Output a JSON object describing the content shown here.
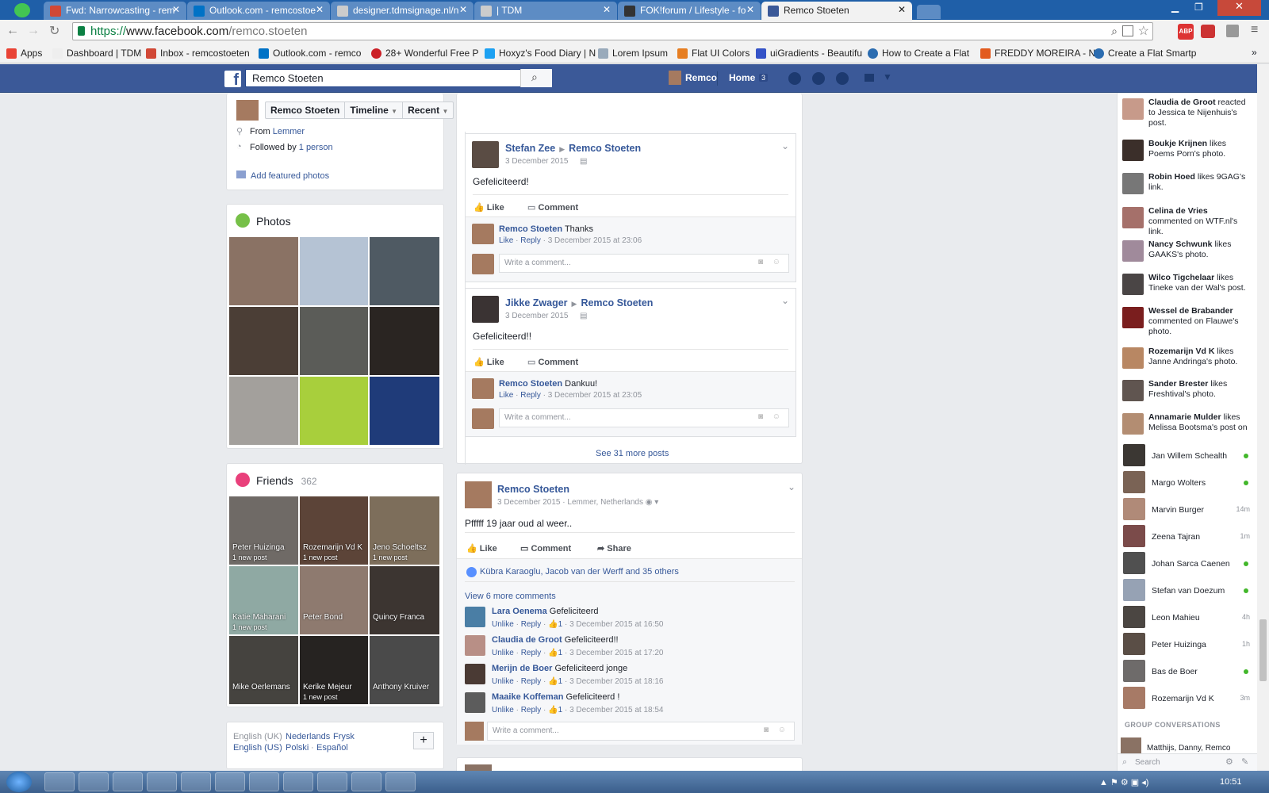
{
  "browser": {
    "tabs": [
      {
        "label": "Fwd: Narrowcasting - rem",
        "active": false
      },
      {
        "label": "Outlook.com - remcostoe",
        "active": false
      },
      {
        "label": "designer.tdmsignage.nl/n",
        "active": false
      },
      {
        "label": "| TDM",
        "active": false
      },
      {
        "label": "FOK!forum / Lifestyle - fo",
        "active": false
      },
      {
        "label": "Remco Stoeten",
        "active": true
      }
    ],
    "url_scheme": "https://",
    "url_host": "www.facebook.com",
    "url_path": "/remco.stoeten",
    "bookmarks": [
      "Apps",
      "Dashboard | TDM",
      "Inbox - remcostoeten",
      "Outlook.com - remco",
      "28+ Wonderful Free P",
      "Hoxyz's Food Diary | N",
      "Lorem Ipsum",
      "Flat UI Colors",
      "uiGradients - Beautifu",
      "How to Create a Flat",
      "FREDDY MOREIRA - N",
      "Create a Flat Smartph"
    ]
  },
  "fb": {
    "search_value": "Remco Stoeten",
    "nav_profile": "Remco",
    "nav_home": "Home",
    "nav_home_count": "3"
  },
  "profile_bar": {
    "name": "Remco Stoeten",
    "timeline": "Timeline",
    "recent": "Recent"
  },
  "intro": {
    "from_label": "From",
    "from_value": "Lemmer",
    "followed_label": "Followed by",
    "followed_value": "1 person",
    "featured": "Add featured photos"
  },
  "photos": {
    "title": "Photos"
  },
  "friends": {
    "title": "Friends",
    "count": "362",
    "items": [
      {
        "name": "Peter Huizinga",
        "sub": "1 new post"
      },
      {
        "name": "Rozemarijn Vd K",
        "sub": "1 new post"
      },
      {
        "name": "Jeno Schoeltsz",
        "sub": "1 new post"
      },
      {
        "name": "Katie Maharani",
        "sub": "1 new post"
      },
      {
        "name": "Peter Bond",
        "sub": ""
      },
      {
        "name": "Quincy Franca",
        "sub": ""
      },
      {
        "name": "Mike Oerlemans",
        "sub": ""
      },
      {
        "name": "Kerike Mejeur",
        "sub": "1 new post"
      },
      {
        "name": "Anthony Kruiver",
        "sub": ""
      }
    ]
  },
  "languages": {
    "current": "English (UK)",
    "l1": "Nederlands",
    "l2": "Frysk",
    "l3": "English (US)",
    "l4": "Polski",
    "l5": "Español"
  },
  "posts": [
    {
      "author": "Stefan Zee",
      "target": "Remco Stoeten",
      "date": "3 December 2015",
      "text": "Gefeliciteerd!",
      "like": "Like",
      "comment": "Comment",
      "reply_author": "Remco Stoeten",
      "reply_text": "Thanks",
      "reply_like": "Like",
      "reply_reply": "Reply",
      "reply_date": "3 December 2015 at 23:06",
      "write": "Write a comment..."
    },
    {
      "author": "Jikke Zwager",
      "target": "Remco Stoeten",
      "date": "3 December 2015",
      "text": "Gefeliciteerd!!",
      "like": "Like",
      "comment": "Comment",
      "reply_author": "Remco Stoeten",
      "reply_text": "Dankuu!",
      "reply_like": "Like",
      "reply_reply": "Reply",
      "reply_date": "3 December 2015 at 23:05",
      "write": "Write a comment..."
    }
  ],
  "see_more": "See 31 more posts",
  "main_post": {
    "author": "Remco Stoeten",
    "date": "3 December 2015",
    "location": "Lemmer, Netherlands",
    "text": "Pfffff 19 jaar oud al weer..",
    "like": "Like",
    "comment": "Comment",
    "share": "Share",
    "likes_line": "Kübra Karaoglu, Jacob van der Werff and 35 others",
    "view_more": "View 6 more comments",
    "comments": [
      {
        "author": "Lara Oenema",
        "text": "Gefeliciteerd",
        "unlike": "Unlike",
        "reply": "Reply",
        "count": "1",
        "date": "3 December 2015 at 16:50"
      },
      {
        "author": "Claudia de Groot",
        "text": "Gefeliciteerd!!",
        "unlike": "Unlike",
        "reply": "Reply",
        "count": "1",
        "date": "3 December 2015 at 17:20"
      },
      {
        "author": "Merijn de Boer",
        "text": "Gefeliciteerd jonge",
        "unlike": "Unlike",
        "reply": "Reply",
        "count": "1",
        "date": "3 December 2015 at 18:16"
      },
      {
        "author": "Maaike Koffeman",
        "text": "Gefeliciteerd !",
        "unlike": "Unlike",
        "reply": "Reply",
        "count": "1",
        "date": "3 December 2015 at 18:54"
      }
    ],
    "write": "Write a comment..."
  },
  "ticker": [
    {
      "name": "Claudia de Groot",
      "rest": "reacted to Jessica te Nijenhuis's post."
    },
    {
      "name": "Boukje Krijnen",
      "rest": "likes Poems Porn's photo."
    },
    {
      "name": "Robin Hoed",
      "rest": "likes 9GAG's link."
    },
    {
      "name": "Celina de Vries",
      "rest": "commented on WTF.nl's link."
    },
    {
      "name": "Nancy Schwunk",
      "rest": "likes GAAKS's photo."
    },
    {
      "name": "Wilco Tigchelaar",
      "rest": "likes Tineke van der Wal's post."
    },
    {
      "name": "Wessel de Brabander",
      "rest": "commented on Flauwe's photo."
    },
    {
      "name": "Rozemarijn Vd K",
      "rest": "likes Janne Andringa's photo."
    },
    {
      "name": "Sander Brester",
      "rest": "likes Freshtival's photo."
    },
    {
      "name": "Annamarie Mulder",
      "rest": "likes Melissa Bootsma's post on"
    }
  ],
  "chat": [
    {
      "name": "Jan Willem Schealth",
      "status": ""
    },
    {
      "name": "Margo Wolters",
      "status": ""
    },
    {
      "name": "Marvin Burger",
      "status": "14m"
    },
    {
      "name": "Zeena Tajran",
      "status": "1m"
    },
    {
      "name": "Johan Sarca Caenen",
      "status": ""
    },
    {
      "name": "Stefan van Doezum",
      "status": ""
    },
    {
      "name": "Leon Mahieu",
      "status": "4h"
    },
    {
      "name": "Peter Huizinga",
      "status": "1h"
    },
    {
      "name": "Bas de Boer",
      "status": ""
    },
    {
      "name": "Rozemarijn Vd K",
      "status": "3m"
    }
  ],
  "group_title": "GROUP CONVERSATIONS",
  "group_item": "Matthijs, Danny, Remco",
  "chat_search": "Search",
  "clock": "10:51",
  "colors": {
    "fb_blue": "#3b5998",
    "link": "#365899"
  }
}
